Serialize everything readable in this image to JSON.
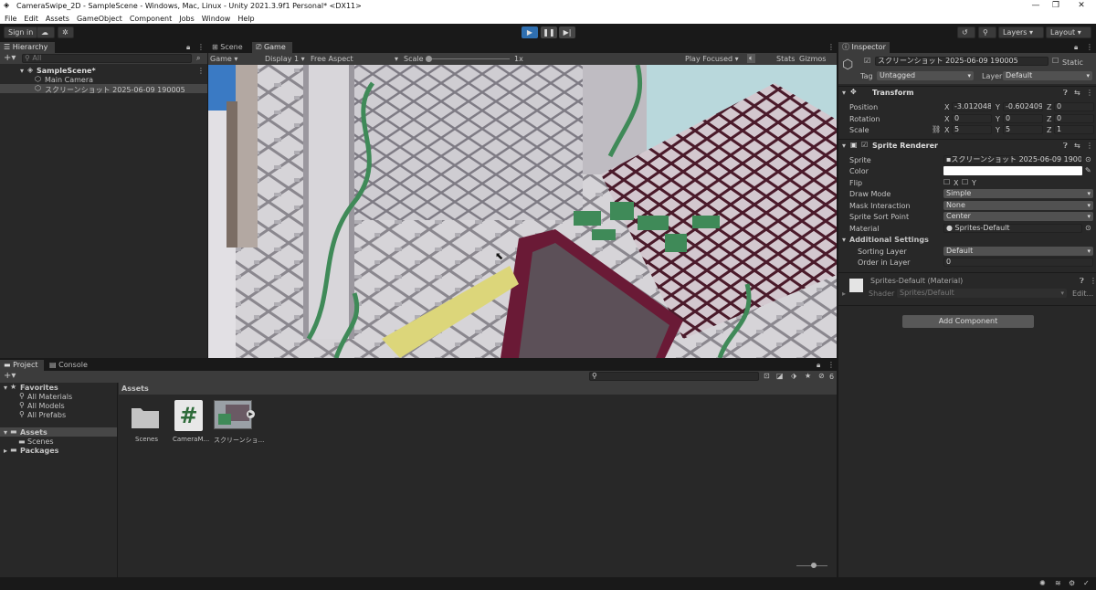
{
  "window": {
    "title": "CameraSwipe_2D - SampleScene - Windows, Mac, Linux - Unity 2021.3.9f1 Personal* <DX11>",
    "controls": [
      "—",
      "❐",
      "✕"
    ]
  },
  "menu": [
    "File",
    "Edit",
    "Assets",
    "GameObject",
    "Component",
    "Jobs",
    "Window",
    "Help"
  ],
  "toolbar": {
    "sign_in": "Sign in",
    "layers": "Layers",
    "layout": "Layout"
  },
  "hierarchy": {
    "tab": "Hierarchy",
    "search_placeholder": "All",
    "scene": "SampleScene*",
    "items": [
      "Main Camera",
      "スクリーンショット 2025-06-09 190005"
    ]
  },
  "game_view": {
    "tabs": [
      "Scene",
      "Game"
    ],
    "mode": "Game",
    "display": "Display 1",
    "aspect": "Free Aspect",
    "scale_label": "Scale",
    "scale_value": "1x",
    "play_focused": "Play Focused",
    "stats": "Stats",
    "gizmos": "Gizmos"
  },
  "inspector": {
    "tab": "Inspector",
    "object_name": "スクリーンショット 2025-06-09 190005",
    "static_label": "Static",
    "tag_label": "Tag",
    "tag_value": "Untagged",
    "layer_label": "Layer",
    "layer_value": "Default",
    "transform": {
      "title": "Transform",
      "position_label": "Position",
      "rotation_label": "Rotation",
      "scale_label": "Scale",
      "position": {
        "x": "-3.012048",
        "y": "-0.602409",
        "z": "0"
      },
      "rotation": {
        "x": "0",
        "y": "0",
        "z": "0"
      },
      "scale": {
        "x": "5",
        "y": "5",
        "z": "1"
      }
    },
    "sprite_renderer": {
      "title": "Sprite Renderer",
      "sprite_label": "Sprite",
      "sprite_value": "スクリーンショット 2025-06-09 190005",
      "color_label": "Color",
      "flip_label": "Flip",
      "flip_x": "X",
      "flip_y": "Y",
      "draw_mode_label": "Draw Mode",
      "draw_mode_value": "Simple",
      "mask_label": "Mask Interaction",
      "mask_value": "None",
      "sort_point_label": "Sprite Sort Point",
      "sort_point_value": "Center",
      "material_label": "Material",
      "material_value": "Sprites-Default",
      "additional_settings": "Additional Settings",
      "sorting_layer_label": "Sorting Layer",
      "sorting_layer_value": "Default",
      "order_label": "Order in Layer",
      "order_value": "0"
    },
    "material": {
      "title": "Sprites-Default (Material)",
      "shader_label": "Shader",
      "shader_value": "Sprites/Default",
      "edit": "Edit..."
    },
    "add_component": "Add Component"
  },
  "project": {
    "tabs": [
      "Project",
      "Console"
    ],
    "favorites_label": "Favorites",
    "favorites": [
      "All Materials",
      "All Models",
      "All Prefabs"
    ],
    "assets_label": "Assets",
    "assets_children": [
      "Scenes"
    ],
    "packages_label": "Packages",
    "breadcrumb": "Assets",
    "hidden_count": "6",
    "files": [
      {
        "name": "Scenes",
        "icon": "folder-icon"
      },
      {
        "name": "CameraM...",
        "icon": "csharp-script-icon"
      },
      {
        "name": "スクリーンショ...",
        "icon": "sprite-thumbnail-icon"
      }
    ]
  },
  "colors": {
    "accent": "#2c5d87",
    "panel": "#282828",
    "header": "#3c3c3c",
    "game_sky": "#b9d8dc",
    "game_wall": "#d8d6da",
    "game_vine": "#3f8a58",
    "game_frame": "#6a1a36",
    "game_yellow": "#dcd67a"
  }
}
